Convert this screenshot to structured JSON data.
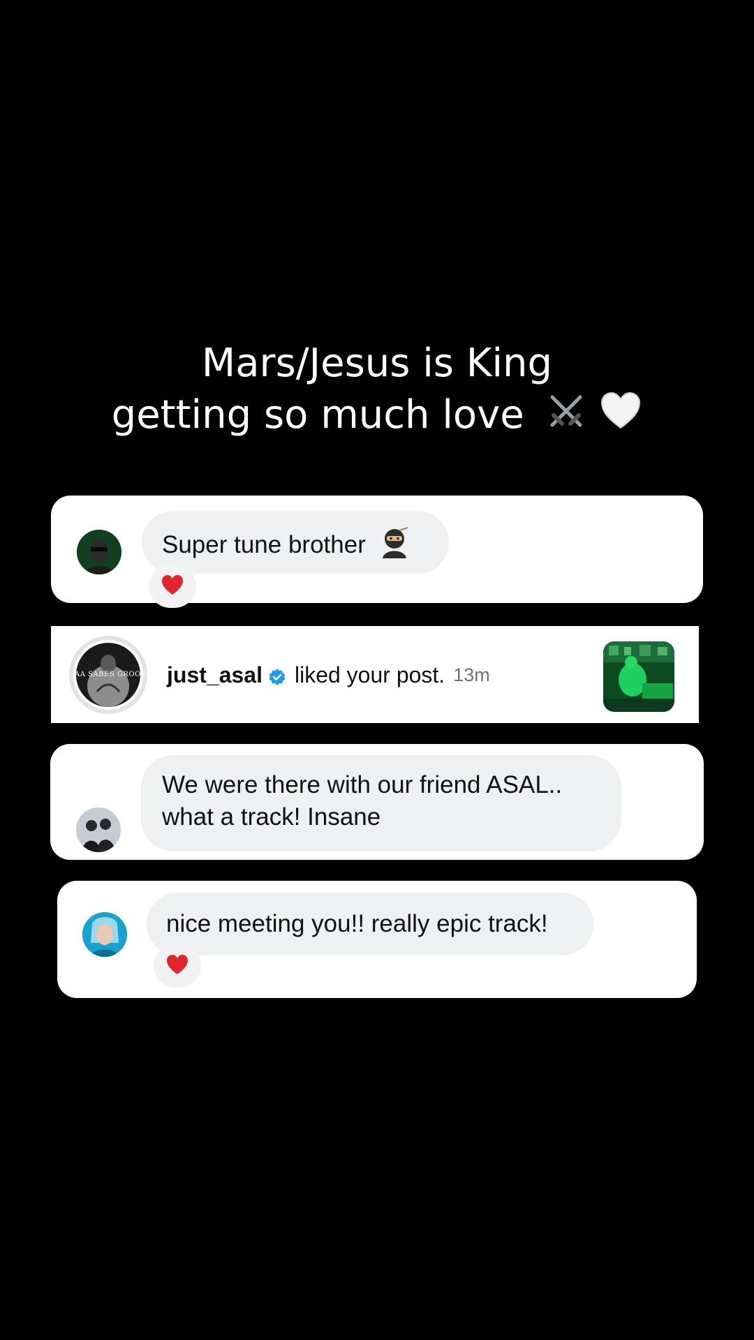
{
  "headline": {
    "line1": "Mars/Jesus is King",
    "line2": "getting so much love",
    "emoji": "swords-and-white-heart"
  },
  "comments": [
    {
      "text": "Super tune brother",
      "emoji": "ninja",
      "reaction": "red-heart"
    },
    {
      "line1": "We were there with our friend ASAL..",
      "line2": "what a track! Insane"
    },
    {
      "text": "nice meeting you!! really epic track!",
      "reaction": "red-heart"
    }
  ],
  "notification": {
    "username": "just_asal",
    "action": "liked your post.",
    "time": "13m",
    "avatar_caption": "AA SABES GROOVE",
    "verified_color": "#1d9bf0"
  },
  "colors": {
    "background": "#000000",
    "card": "#ffffff",
    "bubble": "#eff0f2",
    "heart": "#e0252f"
  }
}
